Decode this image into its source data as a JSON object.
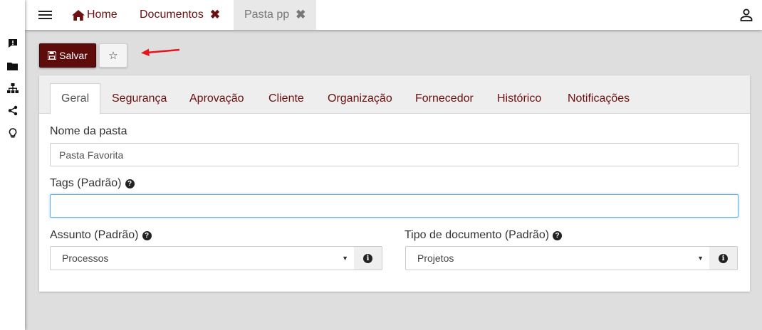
{
  "rail": {
    "icons": [
      "comment-alert-icon",
      "folder-icon",
      "sitemap-icon",
      "share-icon",
      "lightbulb-icon"
    ]
  },
  "topbar": {
    "menu_icon": "hamburger-icon",
    "tabs": [
      {
        "label": "Home",
        "icon": "home-icon"
      },
      {
        "label": "Documentos",
        "close": "✖"
      },
      {
        "label": "Pasta pp",
        "close": "✖"
      }
    ],
    "user_icon": "user-icon"
  },
  "toolbar": {
    "save_label": "Salvar",
    "favorite_glyph": "☆"
  },
  "form": {
    "tabs": [
      "Geral",
      "Segurança",
      "Aprovação",
      "Cliente",
      "Organização",
      "Fornecedor",
      "Histórico",
      "Notificações"
    ],
    "active_tab": "Geral",
    "folder_name_label": "Nome da pasta",
    "folder_name_value": "Pasta Favorita",
    "tags_label": "Tags (Padrão)",
    "tags_value": "",
    "subject_label": "Assunto (Padrão)",
    "subject_value": "Processos",
    "doctype_label": "Tipo de documento (Padrão)",
    "doctype_value": "Projetos",
    "help_glyph": "?",
    "info_glyph": "i",
    "caret_glyph": "▼"
  },
  "colors": {
    "brand": "#5e0b0b",
    "tab_text": "#6b0f0f",
    "annotation_arrow": "#e8141a"
  }
}
